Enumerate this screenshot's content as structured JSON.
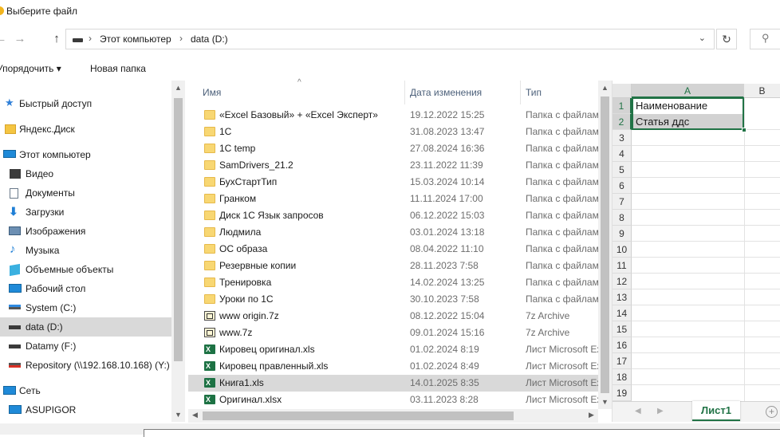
{
  "window": {
    "title": "Выберите файл"
  },
  "address_bar": {
    "crumbs": [
      "Этот компьютер",
      "data (D:)"
    ],
    "separator": "›",
    "refresh_icon": "↻",
    "search_icon": "⚲",
    "back_icon": "←",
    "forward_icon": "→",
    "up_icon": "↑",
    "dropdown_icon": "⌄"
  },
  "toolbar": {
    "organize_label": "Упорядочить ▾",
    "new_folder_label": "Новая папка"
  },
  "nav": {
    "items": [
      {
        "label": "Быстрый доступ",
        "icon": "star-icon"
      },
      {
        "label": "Яндекс.Диск",
        "icon": "folder-icon"
      },
      {
        "label": "Этот компьютер",
        "icon": "computer-icon"
      },
      {
        "label": "Видео",
        "icon": "video-icon"
      },
      {
        "label": "Документы",
        "icon": "documents-icon"
      },
      {
        "label": "Загрузки",
        "icon": "download-icon"
      },
      {
        "label": "Изображения",
        "icon": "pictures-icon"
      },
      {
        "label": "Музыка",
        "icon": "music-icon"
      },
      {
        "label": "Объемные объекты",
        "icon": "3d-objects-icon"
      },
      {
        "label": "Рабочий стол",
        "icon": "desktop-icon"
      },
      {
        "label": "System (C:)",
        "icon": "system-drive-icon"
      },
      {
        "label": "data (D:)",
        "icon": "drive-icon"
      },
      {
        "label": "Datamy (F:)",
        "icon": "drive-icon"
      },
      {
        "label": "Repository (\\\\192.168.10.168) (Y:)",
        "icon": "network-drive-icon"
      },
      {
        "label": "Сеть",
        "icon": "network-icon"
      },
      {
        "label": "ASUPIGOR",
        "icon": "computer-icon"
      }
    ],
    "selected": "data (D:)"
  },
  "list": {
    "columns": {
      "name": "Имя",
      "date": "Дата изменения",
      "type": "Тип"
    },
    "sort_indicator": "^",
    "rows": [
      {
        "name": "«Excel Базовый» + «Excel Эксперт»",
        "date": "19.12.2022 15:25",
        "type": "Папка с файлами",
        "kind": "folder"
      },
      {
        "name": "1С",
        "date": "31.08.2023 13:47",
        "type": "Папка с файлами",
        "kind": "folder"
      },
      {
        "name": "1С temp",
        "date": "27.08.2024 16:36",
        "type": "Папка с файлами",
        "kind": "folder"
      },
      {
        "name": "SamDrivers_21.2",
        "date": "23.11.2022 11:39",
        "type": "Папка с файлами",
        "kind": "folder"
      },
      {
        "name": "БухСтартТип",
        "date": "15.03.2024 10:14",
        "type": "Папка с файлами",
        "kind": "folder"
      },
      {
        "name": "Гранком",
        "date": "11.11.2024 17:00",
        "type": "Папка с файлами",
        "kind": "folder"
      },
      {
        "name": "Диск 1С Язык запросов",
        "date": "06.12.2022 15:03",
        "type": "Папка с файлами",
        "kind": "folder"
      },
      {
        "name": "Людмила",
        "date": "03.01.2024 13:18",
        "type": "Папка с файлами",
        "kind": "folder"
      },
      {
        "name": "ОС образа",
        "date": "08.04.2022 11:10",
        "type": "Папка с файлами",
        "kind": "folder"
      },
      {
        "name": "Резервные копии",
        "date": "28.11.2023 7:58",
        "type": "Папка с файлами",
        "kind": "folder"
      },
      {
        "name": "Тренировка",
        "date": "14.02.2024 13:25",
        "type": "Папка с файлами",
        "kind": "folder"
      },
      {
        "name": "Уроки по 1С",
        "date": "30.10.2023 7:58",
        "type": "Папка с файлами",
        "kind": "folder"
      },
      {
        "name": "www origin.7z",
        "date": "08.12.2022 15:04",
        "type": "7z Archive",
        "kind": "7z"
      },
      {
        "name": "www.7z",
        "date": "09.01.2024 15:16",
        "type": "7z Archive",
        "kind": "7z"
      },
      {
        "name": "Кировец оригинал.xls",
        "date": "01.02.2024 8:19",
        "type": "Лист Microsoft Excel",
        "kind": "xls"
      },
      {
        "name": "Кировец правленный.xls",
        "date": "01.02.2024 8:49",
        "type": "Лист Microsoft Excel",
        "kind": "xls"
      },
      {
        "name": "Книга1.xls",
        "date": "14.01.2025 8:35",
        "type": "Лист Microsoft Excel",
        "kind": "xls",
        "selected": true
      },
      {
        "name": "Оригинал.xlsx",
        "date": "03.11.2023 8:28",
        "type": "Лист Microsoft Excel",
        "kind": "xlsx"
      }
    ]
  },
  "preview": {
    "columns": [
      "A",
      "B"
    ],
    "row_numbers": [
      "1",
      "2",
      "3",
      "4",
      "5",
      "6",
      "7",
      "8",
      "9",
      "10",
      "11",
      "12",
      "13",
      "14",
      "15",
      "16",
      "17",
      "18",
      "19"
    ],
    "cells": {
      "A1": "Наименование",
      "A2": "Статья ддс"
    },
    "sheet_tab": "Лист1",
    "add_sheet": "+",
    "accent": "#217346"
  }
}
